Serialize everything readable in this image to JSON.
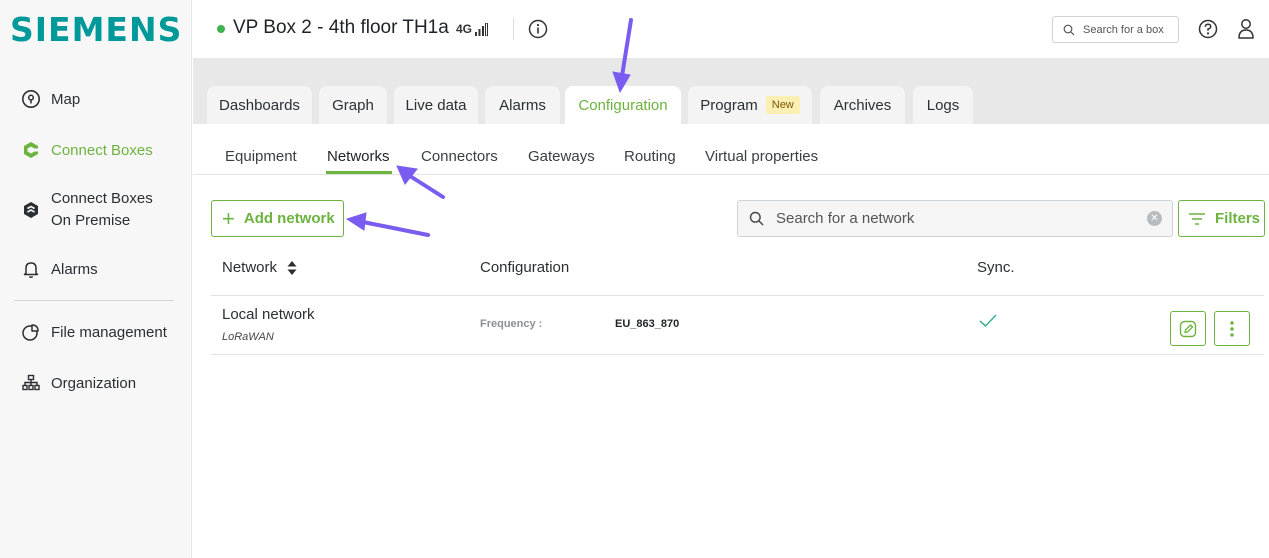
{
  "brand": {
    "logo_text": "SIEMENS",
    "logo_color": "#009999",
    "accent": "#6cb33f",
    "annotation_color": "#7b5cf0"
  },
  "sidebar": {
    "items": [
      {
        "label": "Map",
        "icon": "map-pin-icon"
      },
      {
        "label": "Connect Boxes",
        "icon": "connect-box-icon",
        "active": true
      },
      {
        "label_line1": "Connect Boxes",
        "label_line2": "On Premise",
        "icon": "on-premise-icon"
      },
      {
        "label": "Alarms",
        "icon": "bell-icon"
      },
      {
        "label": "File management",
        "icon": "file-icon"
      },
      {
        "label": "Organization",
        "icon": "org-chart-icon"
      }
    ]
  },
  "header": {
    "box_title": "VP Box 2 - 4th floor TH1a",
    "network_badge": "4G",
    "status_color": "#3fb34f",
    "search_placeholder": "Search for a box"
  },
  "tabs": [
    {
      "label": "Dashboards"
    },
    {
      "label": "Graph"
    },
    {
      "label": "Live data"
    },
    {
      "label": "Alarms"
    },
    {
      "label": "Configuration",
      "active": true
    },
    {
      "label": "Program",
      "badge": "New"
    },
    {
      "label": "Archives"
    },
    {
      "label": "Logs"
    }
  ],
  "subtabs": [
    {
      "label": "Equipment"
    },
    {
      "label": "Networks",
      "active": true
    },
    {
      "label": "Connectors"
    },
    {
      "label": "Gateways"
    },
    {
      "label": "Routing"
    },
    {
      "label": "Virtual properties"
    }
  ],
  "toolbar": {
    "add_label": "Add network",
    "search_placeholder": "Search for a network",
    "filters_label": "Filters"
  },
  "table": {
    "headers": {
      "network": "Network",
      "configuration": "Configuration",
      "sync": "Sync."
    },
    "rows": [
      {
        "name": "Local network",
        "type": "LoRaWAN",
        "config_label": "Frequency :",
        "config_value": "EU_863_870",
        "synced": true
      }
    ]
  }
}
